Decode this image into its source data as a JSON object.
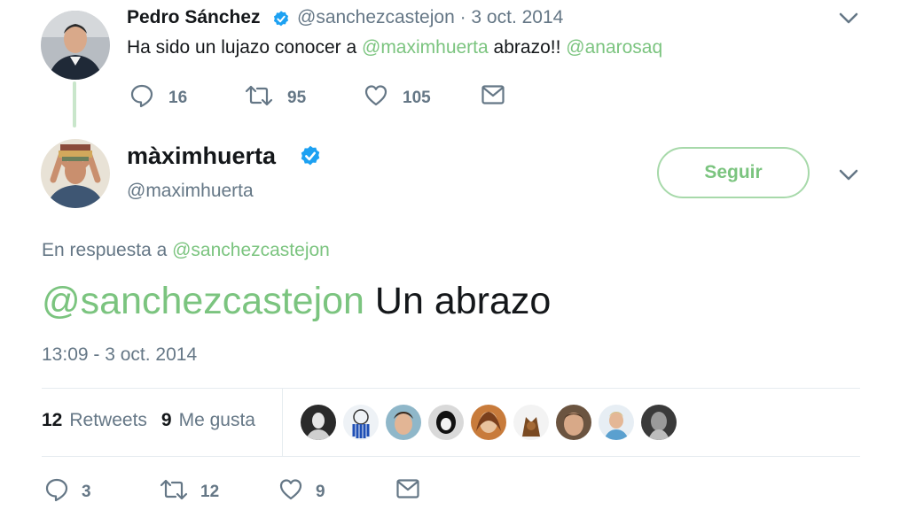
{
  "tweet1": {
    "name": "Pedro Sánchez",
    "handle_date": "@sanchezcastejon · 3 oct. 2014",
    "text_before": "Ha sido un lujazo conocer a ",
    "mention1": "@maximhuerta",
    "text_middle": " abrazo!! ",
    "mention2": "@anarosaq",
    "replies": "16",
    "retweets": "95",
    "likes": "105"
  },
  "tweet2": {
    "name": "màximhuerta",
    "handle": "@maximhuerta",
    "follow_label": "Seguir",
    "reply_prefix": "En respuesta a ",
    "reply_handle": "@sanchezcastejon",
    "mention": "@sanchezcastejon",
    "text": " Un abrazo",
    "timestamp": "13:09 - 3 oct. 2014",
    "retweets_count": "12",
    "retweets_label": "Retweets",
    "likes_count": "9",
    "likes_label": "Me gusta",
    "footer_replies": "3",
    "footer_retweets": "12",
    "footer_likes": "9"
  },
  "colors": {
    "accent": "#7bc47f",
    "verified": "#1da1f2",
    "muted": "#657786",
    "text": "#14171a"
  },
  "icons": [
    "verified-badge-icon",
    "reply-icon",
    "retweet-icon",
    "heart-icon",
    "envelope-icon",
    "chevron-down-icon"
  ]
}
